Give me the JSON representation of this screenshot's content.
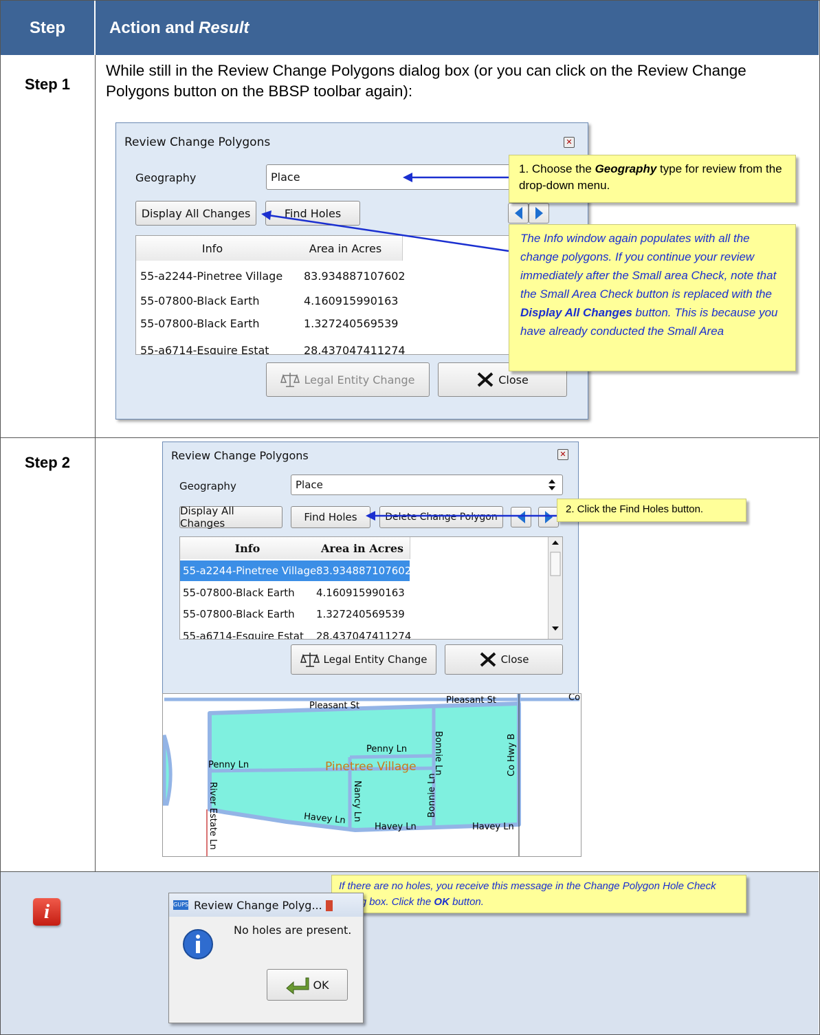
{
  "header": {
    "step_col": "Step",
    "action_col": "Action and ",
    "action_col_italic": "Result"
  },
  "step1": {
    "label": "Step 1",
    "text": "While still in the Review Change Polygons dialog box (or you can click on the Review Change Polygons button on the BBSP toolbar again):",
    "dialog": {
      "title": "Review Change Polygons",
      "geography_label": "Geography",
      "geography_value": "Place",
      "display_all_label": "Display All Changes",
      "find_holes_label": "Find Holes",
      "col_info": "Info",
      "col_area": "Area in Acres",
      "rows": [
        {
          "info": "55-a2244-Pinetree Village",
          "area": "83.934887107602"
        },
        {
          "info": "55-07800-Black Earth",
          "area": "4.160915990163"
        },
        {
          "info": "55-07800-Black Earth",
          "area": "1.327240569539"
        },
        {
          "info": "55-a6714-Esquire Estat",
          "area": "28.437047411274"
        }
      ],
      "legal_label": "Legal Entity Change",
      "close_label": "Close"
    },
    "callout1_a": "1. Choose the ",
    "callout1_b": "Geography",
    "callout1_c": " type for review from the drop-down menu.",
    "callout2_a": "The Info window again populates with all the change polygons. If you continue your review immediately after the Small area Check, note that the Small Area Check button is replaced with the ",
    "callout2_b": "Display All Changes",
    "callout2_c": " button.  This is because you have already conducted the Small Area"
  },
  "step2": {
    "label": "Step 2",
    "dialog": {
      "title": "Review Change Polygons",
      "geography_label": "Geography",
      "geography_value": "Place",
      "display_all_label": "Display All Changes",
      "find_holes_label": "Find Holes",
      "delete_label": "Delete Change Polygon",
      "col_info": "Info",
      "col_area": "Area in Acres",
      "rows": [
        {
          "info": "55-a2244-Pinetree Village",
          "area": "83.934887107602"
        },
        {
          "info": "55-07800-Black Earth",
          "area": "4.160915990163"
        },
        {
          "info": "55-07800-Black Earth",
          "area": "1.327240569539"
        },
        {
          "info": "55-a6714-Esquire Estat",
          "area": "28.437047411274"
        }
      ],
      "legal_label": "Legal Entity Change",
      "close_label": "Close"
    },
    "callout": "2. Click the Find Holes button.",
    "map": {
      "streets": [
        "Pleasant St",
        "Pleasant St",
        "Bonnie Ln",
        "Co Hwy B",
        "Penny Ln",
        "Penny Ln",
        "Nancy Ln",
        "Bonnie Ln",
        "River Estate Ln",
        "Havey Ln",
        "Havey Ln",
        "Havey Ln",
        "Co"
      ],
      "place": "Pinetree Village"
    }
  },
  "info_row": {
    "callout_a": "If there are no holes, you receive this message in the Change Polygon Hole Check dialog box. Click the ",
    "callout_b": "OK",
    "callout_c": " button.",
    "dialog_title": "Review Change Polyg...",
    "app_badge": "GUPS",
    "message": "No holes are present.",
    "ok_label": "OK"
  },
  "colors": {
    "header_bg": "#3d6496",
    "note_bg": "#d9e2ef",
    "callout_bg": "#ffff99",
    "map_fill": "#7ff0df",
    "arrow": "#1a2fd0"
  }
}
